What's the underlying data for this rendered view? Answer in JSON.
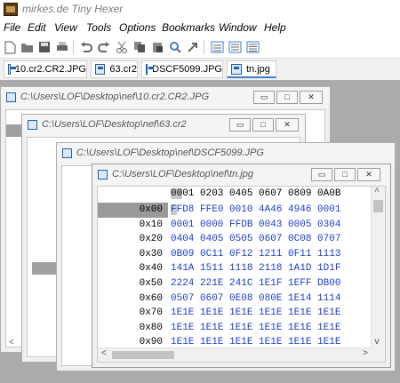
{
  "app": {
    "title": "mirkes.de Tiny Hexer"
  },
  "menu": [
    "File",
    "Edit",
    "View",
    "Tools",
    "Options",
    "Bookmarks",
    "Window",
    "Help"
  ],
  "toolbar": {
    "icons": [
      "new-file-icon",
      "open-file-icon",
      "save-icon",
      "print-icon",
      "undo-icon",
      "redo-icon",
      "cut-icon",
      "copy-icon",
      "paste-icon",
      "find-icon",
      "goto-icon",
      "view-hex-icon",
      "view-split-icon",
      "view-text-icon"
    ]
  },
  "tabs": [
    {
      "label": "10.cr2.CR2.JPG"
    },
    {
      "label": "63.cr2"
    },
    {
      "label": "DSCF5099.JPG"
    },
    {
      "label": "tn.jpg"
    }
  ],
  "windows": {
    "w1": {
      "title": "C:\\Users\\LOF\\Desktop\\nef\\10.cr2.CR2.JPG"
    },
    "w2": {
      "title": "C:\\Users\\LOF\\Desktop\\nef\\63.cr2"
    },
    "w3": {
      "title": "C:\\Users\\LOF\\Desktop\\nef\\DSCF5099.JPG"
    },
    "w4": {
      "title": "C:\\Users\\LOF\\Desktop\\nef\\tn.jpg"
    }
  },
  "hex": {
    "column_header": "0001 0203 0405 0607 0809 0A0B",
    "column_header_first": "00",
    "column_header_rest": "01 0203 0405 0607 0809 0A0B",
    "offsets": [
      "0x00",
      "0x10",
      "0x20",
      "0x30",
      "0x40",
      "0x50",
      "0x60",
      "0x70",
      "0x80",
      "0x90"
    ],
    "selected_offset": "0x00",
    "rows": [
      "FFD8 FFE0 0010 4A46 4946 0001",
      "0001 0000 FFDB 0043 0005 0304",
      "0404 0405 0505 0607 0C08 0707",
      "0B09 0C11 0F12 1211 0F11 1113",
      "141A 1511 1118 2118 1A1D 1D1F",
      "2224 221E 241C 1E1F 1EFF DB00",
      "0507 0607 0E08 080E 1E14 1114",
      "1E1E 1E1E 1E1E 1E1E 1E1E 1E1E",
      "1E1E 1E1E 1E1E 1E1E 1E1E 1E1E",
      "1E1E 1E1E 1E1E 1E1E 1E1E 1E1E"
    ],
    "cursor_char": "F",
    "row0_rest": "FD8 FFE0 0010 4A46 4946 0001"
  },
  "window_buttons": {
    "minimize": "▭",
    "maximize": "□",
    "close": "✕"
  },
  "colors": {
    "hex_text": "#1a3cc8",
    "tab_active_underline": "#3d7bd5",
    "workspace": "#ababab"
  }
}
